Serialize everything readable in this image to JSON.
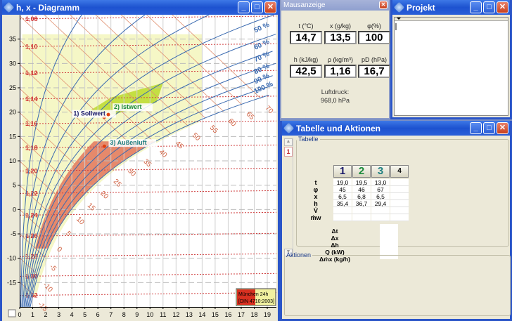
{
  "diagram_window": {
    "title": "h, x - Diagramm"
  },
  "mouse_window": {
    "title": "Mausanzeige",
    "fields": [
      {
        "label": "t (°C)",
        "value": "14,7"
      },
      {
        "label": "x (g/kg)",
        "value": "13,5"
      },
      {
        "label": "φ(%)",
        "value": "100"
      },
      {
        "label": "h (kJ/kg)",
        "value": "42,5"
      },
      {
        "label": "ρ (kg/m³)",
        "value": "1,16"
      },
      {
        "label": "pD (hPa)",
        "value": "16,7"
      }
    ],
    "pressure_label": "Luftdruck:",
    "pressure_value": "968,0 hPa"
  },
  "project_window": {
    "title": "Projekt"
  },
  "table_window": {
    "title": "Tabelle und Aktionen",
    "tab": "1",
    "group_table": "Tabelle",
    "group_actions": "Aktionen",
    "columns": [
      {
        "label": "1",
        "color": "#1a1a6a"
      },
      {
        "label": "2",
        "color": "#1a8a3a"
      },
      {
        "label": "3",
        "color": "#208080"
      },
      {
        "label": "4",
        "color": "#000000"
      }
    ],
    "row_labels": [
      "t",
      "φ",
      "x",
      "h",
      "V̇",
      "ṁw"
    ],
    "rows": [
      [
        "19,0",
        "19,5",
        "13,0",
        ""
      ],
      [
        "45",
        "46",
        "67",
        ""
      ],
      [
        "6,5",
        "6,8",
        "6,5",
        ""
      ],
      [
        "35,4",
        "36,7",
        "29,4",
        ""
      ],
      [
        "",
        "",
        "",
        ""
      ],
      [
        "",
        "",
        "",
        ""
      ]
    ],
    "delta_labels": [
      "Δt",
      "Δx",
      "Δh",
      "Q (kW)",
      "Δṁx (kg/h)"
    ],
    "delta_values": [
      "",
      "",
      "",
      "",
      ""
    ]
  },
  "chart_data": {
    "type": "psychrometric",
    "xlabel": "x (g/kg)",
    "ylabel": "t (°C)",
    "xlim": [
      0,
      19.7
    ],
    "ylim": [
      -20,
      40
    ],
    "pressure_hPa": 968,
    "x_ticks": [
      0,
      1,
      2,
      3,
      4,
      5,
      6,
      7,
      8,
      9,
      10,
      11,
      12,
      13,
      14,
      15,
      16,
      17,
      18,
      19
    ],
    "y_ticks": [
      -15,
      -10,
      -5,
      0,
      5,
      10,
      15,
      20,
      25,
      30,
      35
    ],
    "rh_lines": [
      10,
      20,
      30,
      40,
      50,
      60,
      70,
      80,
      90,
      100
    ],
    "rh_unit": "%",
    "enthalpy_lines": [
      -15,
      -10,
      -5,
      0,
      5,
      10,
      15,
      20,
      25,
      30,
      35,
      40,
      45,
      50,
      55,
      60,
      65,
      70
    ],
    "density_lines": [
      "1,08",
      "1,10",
      "1,12",
      "1,14",
      "1,16",
      "1,18",
      "1,20",
      "1,22",
      "1,24",
      "1,26",
      "1,28",
      "1,30",
      "1,32"
    ],
    "points": [
      {
        "label": "1) Sollwert",
        "t": 19.0,
        "x": 6.5,
        "color": "#1a1a6a"
      },
      {
        "label": "2) Istwert",
        "t": 19.5,
        "x": 6.8,
        "color": "#1a8a3a"
      },
      {
        "label": "3) Außenluft",
        "t": 13.0,
        "x": 6.5,
        "color": "#208080"
      }
    ],
    "legend": [
      "München 24h",
      "[DIN 4710:2003]"
    ],
    "legend_position": "bottom-right"
  }
}
